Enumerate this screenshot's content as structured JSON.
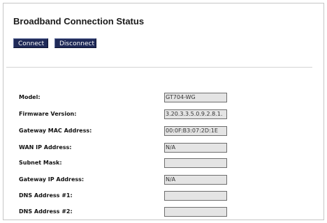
{
  "page": {
    "title": "Broadband Connection Status"
  },
  "buttons": {
    "connect_label": "Connect",
    "disconnect_label": "Disconnect"
  },
  "status_rows": [
    {
      "label": "Model:",
      "value": "GT704-WG"
    },
    {
      "label": "Firmware Version:",
      "value": "3.20.3.3.5.0.9.2.8.1."
    },
    {
      "label": "Gateway MAC Address:",
      "value": "00:0F:B3:07:2D:1E"
    },
    {
      "label": "WAN IP Address:",
      "value": "N/A"
    },
    {
      "label": "Subnet Mask:",
      "value": ""
    },
    {
      "label": "Gateway IP Address:",
      "value": "N/A"
    },
    {
      "label": "DNS Address #1:",
      "value": ""
    },
    {
      "label": "DNS Address #2:",
      "value": ""
    }
  ],
  "colors": {
    "button_bg": "#1f2a58",
    "field_bg": "#e4e4e4",
    "divider": "#d4d4d4"
  }
}
